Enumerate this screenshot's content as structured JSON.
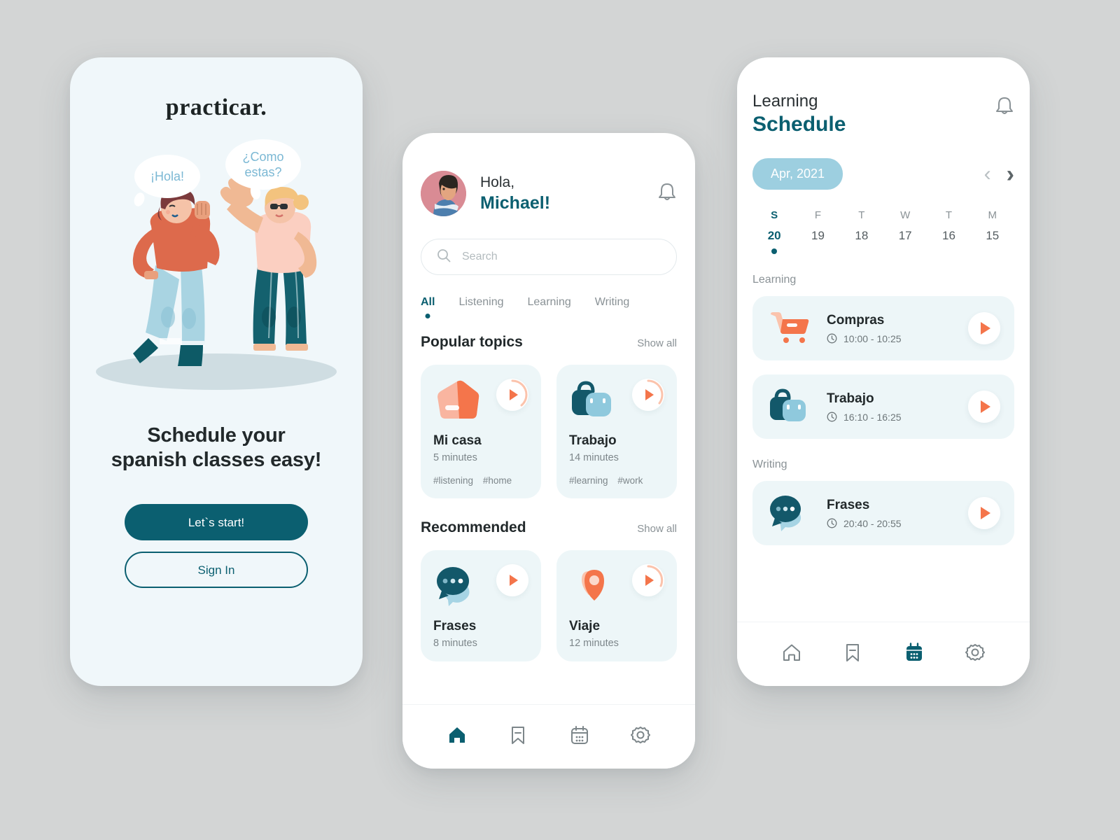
{
  "canvas": {
    "background": "#d3d5d5"
  },
  "palette": {
    "teal": "#0b5f70",
    "orange": "#f4754b",
    "light_blue": "#9dcfe0",
    "card_bg": "#edf6f8",
    "screen1_bg": "#f0f7fa"
  },
  "onboarding": {
    "brand": "practicar.",
    "bubble_left": "¡Hola!",
    "bubble_right": "¿Como estas?",
    "headline_line1": "Schedule your",
    "headline_line2": "spanish classes easy!",
    "primary_button": "Let`s start!",
    "secondary_button": "Sign In"
  },
  "home": {
    "greeting": "Hola,",
    "user_name": "Michael!",
    "bell_icon": "bell-icon",
    "search": {
      "value": "",
      "placeholder": "Search"
    },
    "tabs": [
      {
        "label": "All",
        "active": true
      },
      {
        "label": "Listening",
        "active": false
      },
      {
        "label": "Learning",
        "active": false
      },
      {
        "label": "Writing",
        "active": false
      }
    ],
    "sections": [
      {
        "title": "Popular topics",
        "link": "Show all",
        "cards": [
          {
            "name": "Mi casa",
            "duration": "5 minutes",
            "tags": [
              "#listening",
              "#home"
            ],
            "art": "house-icon"
          },
          {
            "name": "Trabajo",
            "duration": "14 minutes",
            "tags": [
              "#learning",
              "#work"
            ],
            "art": "briefcase-icon"
          }
        ]
      },
      {
        "title": "Recommended",
        "link": "Show all",
        "cards": [
          {
            "name": "Frases",
            "duration": "8 minutes",
            "tags": [],
            "art": "chat-bubble-icon"
          },
          {
            "name": "Viaje",
            "duration": "12 minutes",
            "tags": [],
            "art": "map-pin-icon"
          }
        ]
      }
    ],
    "nav": [
      {
        "icon": "home-icon",
        "active": true
      },
      {
        "icon": "bookmark-icon",
        "active": false
      },
      {
        "icon": "calendar-icon",
        "active": false
      },
      {
        "icon": "gear-icon",
        "active": false
      }
    ]
  },
  "schedule": {
    "title_small": "Learning",
    "title_large": "Schedule",
    "bell_icon": "bell-icon",
    "month": "Apr, 2021",
    "prev_arrow": "‹",
    "next_arrow": "›",
    "days": [
      {
        "dow": "S",
        "num": "20",
        "selected": true
      },
      {
        "dow": "F",
        "num": "19",
        "selected": false
      },
      {
        "dow": "T",
        "num": "18",
        "selected": false
      },
      {
        "dow": "W",
        "num": "17",
        "selected": false
      },
      {
        "dow": "T",
        "num": "16",
        "selected": false
      },
      {
        "dow": "M",
        "num": "15",
        "selected": false
      }
    ],
    "groups": [
      {
        "label": "Learning",
        "items": [
          {
            "name": "Compras",
            "time": "10:00 - 10:25",
            "art": "shopping-cart-icon"
          },
          {
            "name": "Trabajo",
            "time": "16:10 - 16:25",
            "art": "briefcase-icon"
          }
        ]
      },
      {
        "label": "Writing",
        "items": [
          {
            "name": "Frases",
            "time": "20:40 - 20:55",
            "art": "chat-bubble-icon"
          }
        ]
      }
    ],
    "nav": [
      {
        "icon": "home-icon",
        "active": false
      },
      {
        "icon": "bookmark-icon",
        "active": false
      },
      {
        "icon": "calendar-icon",
        "active": true
      },
      {
        "icon": "gear-icon",
        "active": false
      }
    ]
  }
}
